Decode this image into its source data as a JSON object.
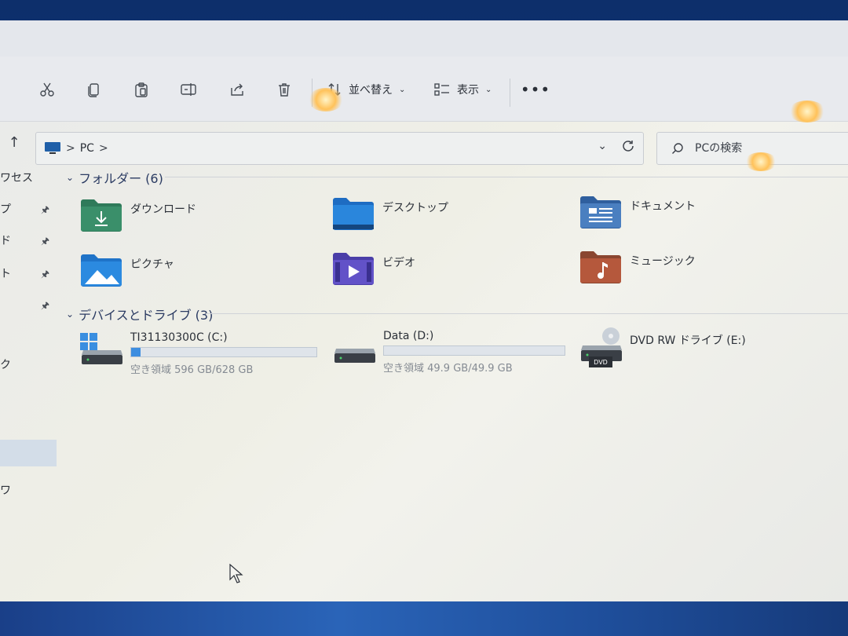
{
  "toolbar": {
    "cut_icon": "scissors-icon",
    "copy_icon": "copy-icon",
    "paste_icon": "clipboard-icon",
    "rename_icon": "rename-icon",
    "share_icon": "share-icon",
    "delete_icon": "trash-icon",
    "sort_label": "並べ替え",
    "view_label": "表示",
    "more_label": "•••"
  },
  "address": {
    "crumbs": [
      "PC"
    ],
    "separator": ">"
  },
  "search": {
    "placeholder": "PCの検索"
  },
  "sidebar": {
    "items": [
      "ワセス",
      "プ",
      "ド",
      "ト",
      "ク",
      "ワ"
    ]
  },
  "folders": {
    "header": "フォルダー (6)",
    "items": [
      {
        "label": "ダウンロード",
        "icon": "downloads-folder-icon",
        "color": "#2f7a5a"
      },
      {
        "label": "デスクトップ",
        "icon": "desktop-folder-icon",
        "color": "#2a7fd4"
      },
      {
        "label": "ドキュメント",
        "icon": "documents-folder-icon",
        "color": "#3d6fb0"
      },
      {
        "label": "ピクチャ",
        "icon": "pictures-folder-icon",
        "color": "#2b8ae0"
      },
      {
        "label": "ビデオ",
        "icon": "videos-folder-icon",
        "color": "#5a4bc0"
      },
      {
        "label": "ミュージック",
        "icon": "music-folder-icon",
        "color": "#b5583c"
      }
    ]
  },
  "drives": {
    "header": "デバイスとドライブ (3)",
    "items": [
      {
        "name": "TI31130300C (C:)",
        "free": "空き領域 596 GB/628 GB",
        "used_fraction": 0.05,
        "icon": "windows-drive-icon"
      },
      {
        "name": "Data (D:)",
        "free": "空き領域 49.9 GB/49.9 GB",
        "used_fraction": 0.0,
        "icon": "hard-drive-icon"
      },
      {
        "name": "DVD RW ドライブ (E:)",
        "dvd_text": "DVD",
        "icon": "dvd-drive-icon"
      }
    ]
  }
}
